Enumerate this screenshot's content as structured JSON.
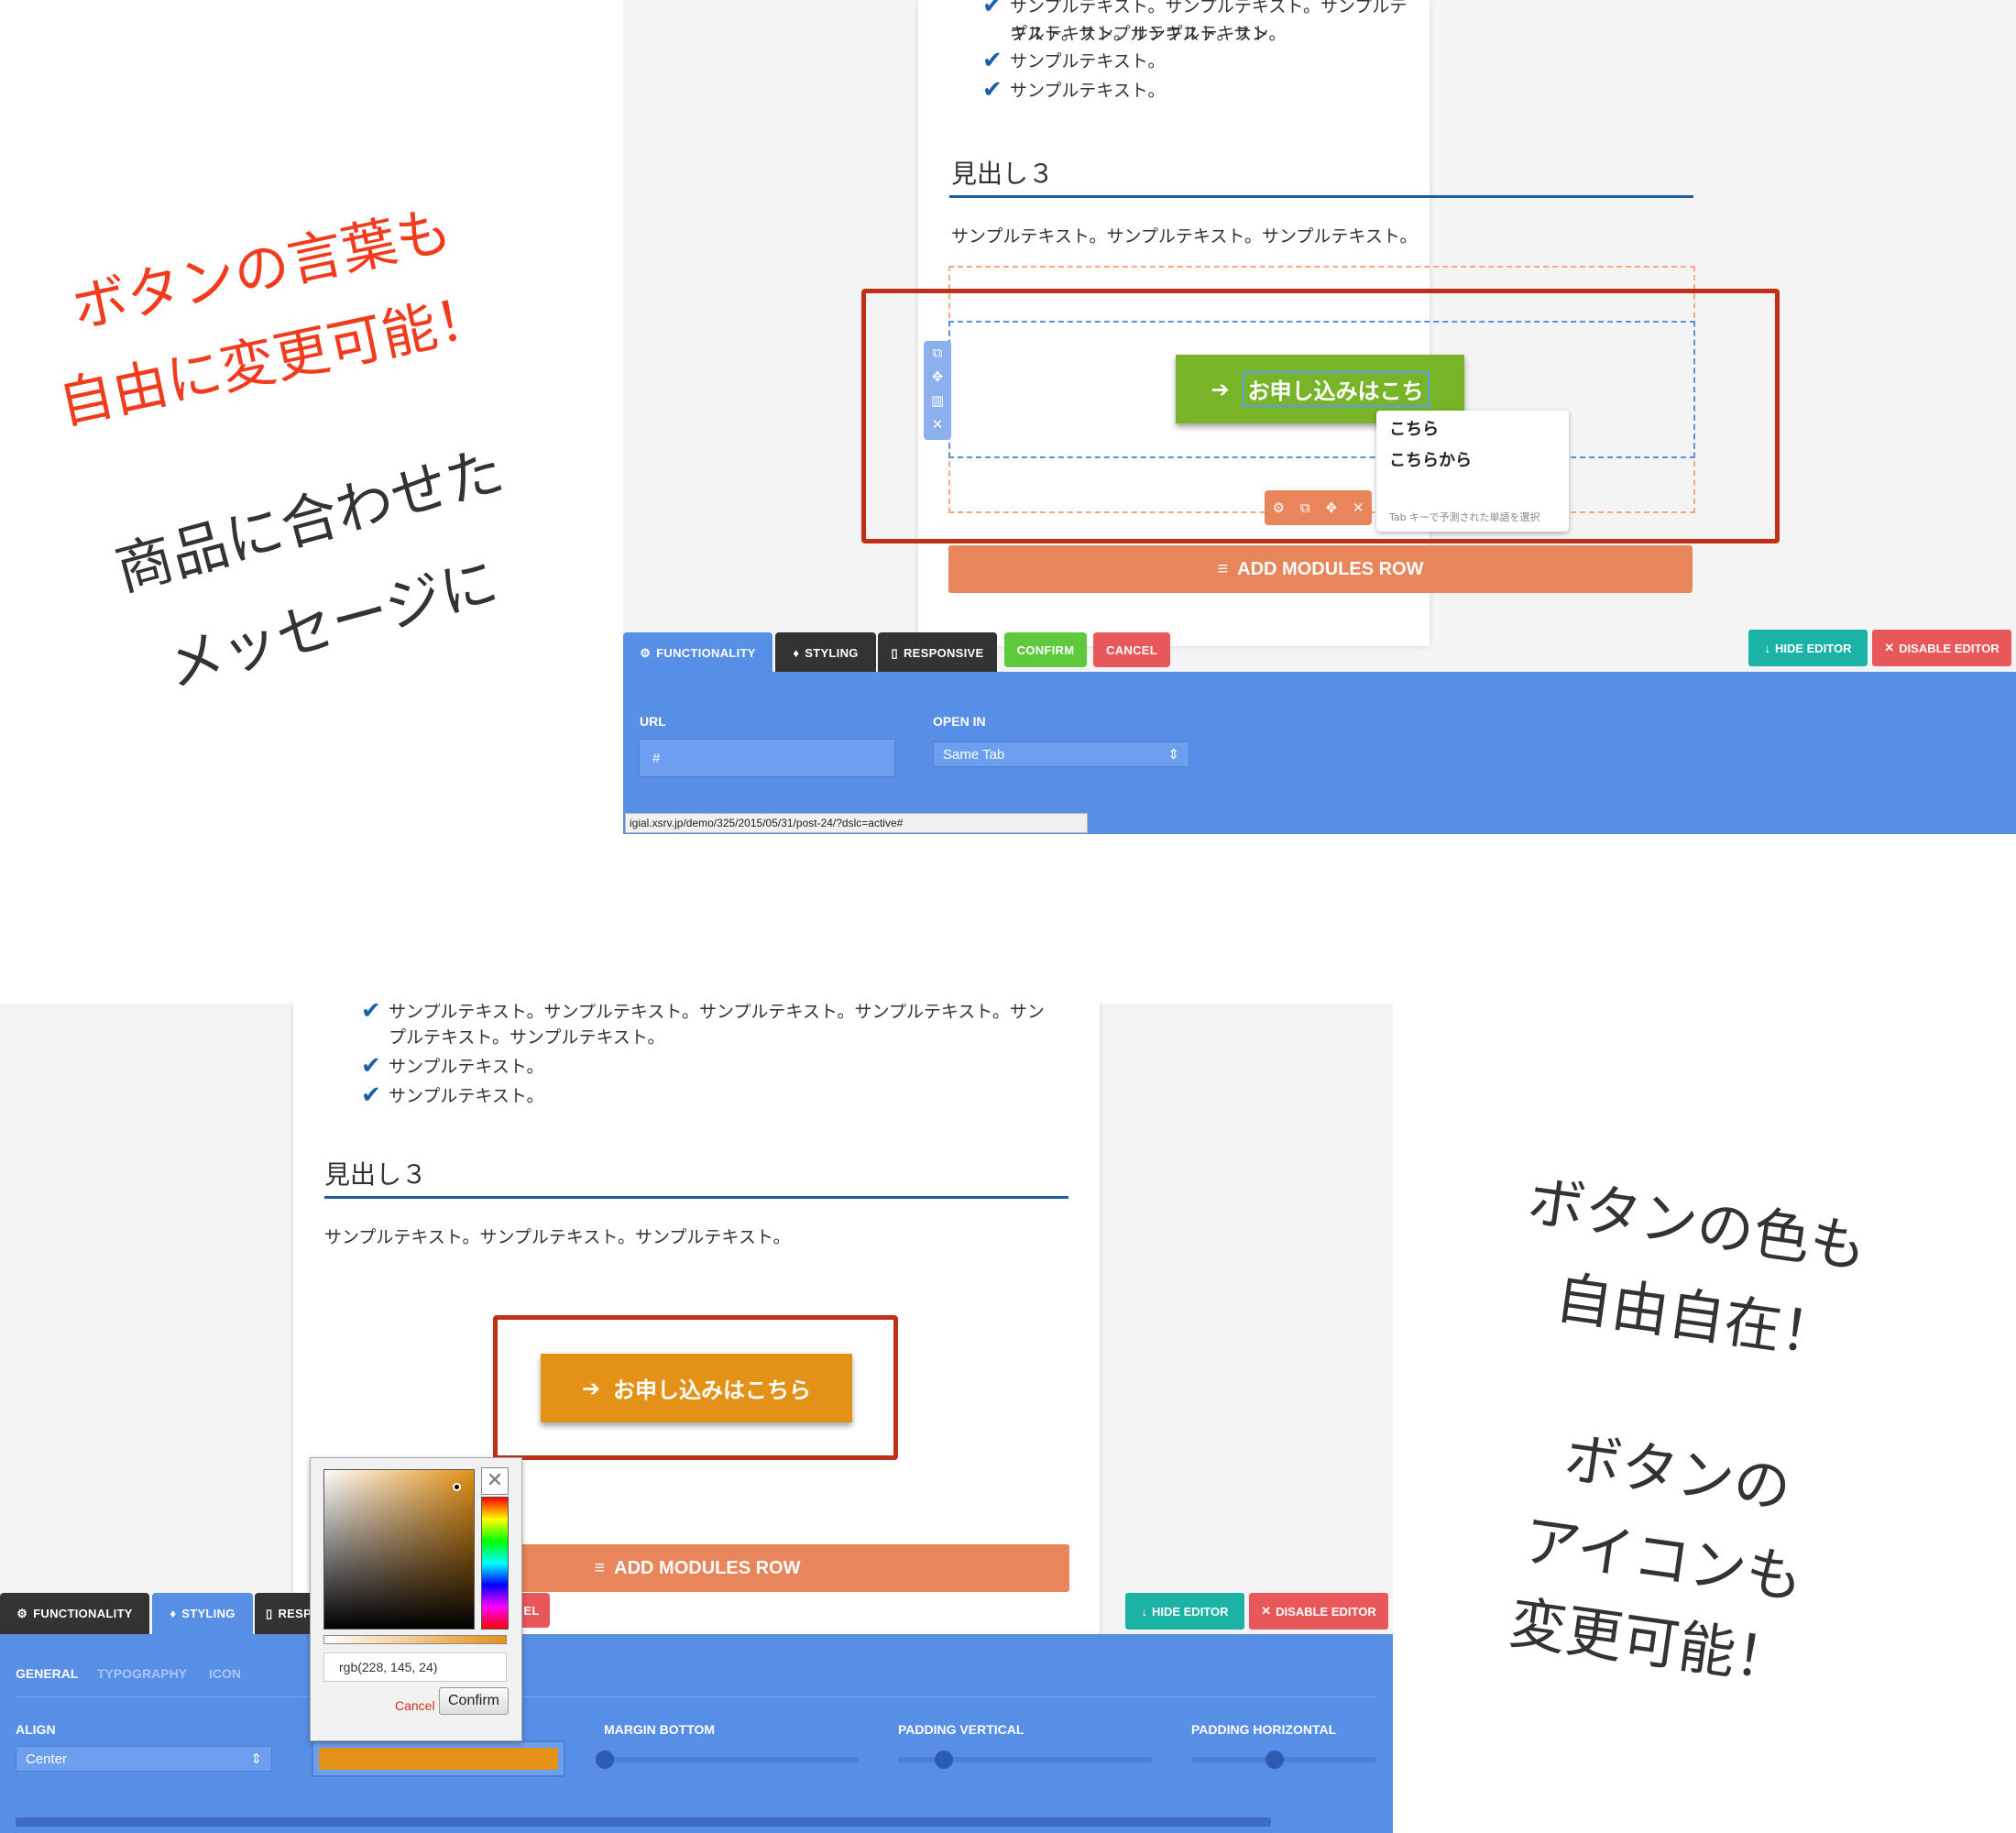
{
  "top": {
    "list_item_1": "サンプルテキスト。サンプルテキスト。サンプルテキスト。サンプルテキスト。サン",
    "list_item_1b": "プルテキスト。サンプルテキスト。",
    "list_item_2": "サンプルテキスト。",
    "list_item_3": "サンプルテキスト。",
    "heading": "見出し３",
    "paragraph": "サンプルテキスト。サンプルテキスト。サンプルテキスト。",
    "button_text": "お申し込みはこち",
    "suggestions": [
      "こちら",
      "こちらから"
    ],
    "suggest_hint": "Tab キーで予測された単語を選択",
    "add_modules_row": "ADD MODULES ROW",
    "tabs": {
      "functionality": "FUNCTIONALITY",
      "styling": "STYLING",
      "responsive": "RESPONSIVE",
      "confirm": "CONFIRM",
      "cancel": "CANCEL"
    },
    "hide_editor": "HIDE EDITOR",
    "disable_editor": "DISABLE EDITOR",
    "url_label": "URL",
    "url_value": "#",
    "open_in_label": "OPEN IN",
    "open_in_value": "Same Tab",
    "status_url": "igial.xsrv.jp/demo/325/2015/05/31/post-24/?dslc=active#"
  },
  "bottom": {
    "list_item_1": "サンプルテキスト。サンプルテキスト。サンプルテキスト。サンプルテキスト。サン",
    "list_item_1b": "プルテキスト。サンプルテキスト。",
    "list_item_2": "サンプルテキスト。",
    "list_item_3": "サンプルテキスト。",
    "heading": "見出し３",
    "paragraph": "サンプルテキスト。サンプルテキスト。サンプルテキスト。",
    "button_text": "お申し込みはこちら",
    "add_modules_row": "ADD MODULES ROW",
    "tabs": {
      "functionality": "FUNCTIONALITY",
      "styling": "STYLING",
      "responsive": "RESP",
      "cancel": "EL"
    },
    "hide_editor": "HIDE EDITOR",
    "disable_editor": "DISABLE EDITOR",
    "subtabs": [
      "GENERAL",
      "TYPOGRAPHY",
      "ICON"
    ],
    "align_label": "ALIGN",
    "align_value": "Center",
    "margin_bottom_label": "MARGIN BOTTOM",
    "padding_vertical_label": "PADDING VERTICAL",
    "padding_horizontal_label": "PADDING HORIZONTAL",
    "color_value": "rgb(228, 145, 24)",
    "picker_cancel": "Cancel",
    "picker_confirm": "Confirm"
  },
  "notes": {
    "red_line1": "ボタンの言葉も",
    "red_line2": "自由に変更可能！",
    "dark_line1": "商品に合わせた",
    "dark_line2": "メッセージに",
    "right_line1": "ボタンの色も",
    "right_line2": "自由自在！",
    "right_line3": "ボタンの",
    "right_line4": "アイコンも",
    "right_line5": "変更可能！"
  },
  "colors": {
    "green_button": "#78b428",
    "orange_button": "#e49118",
    "editor_blue": "#578ee6",
    "accent_red": "#f23b1c"
  }
}
